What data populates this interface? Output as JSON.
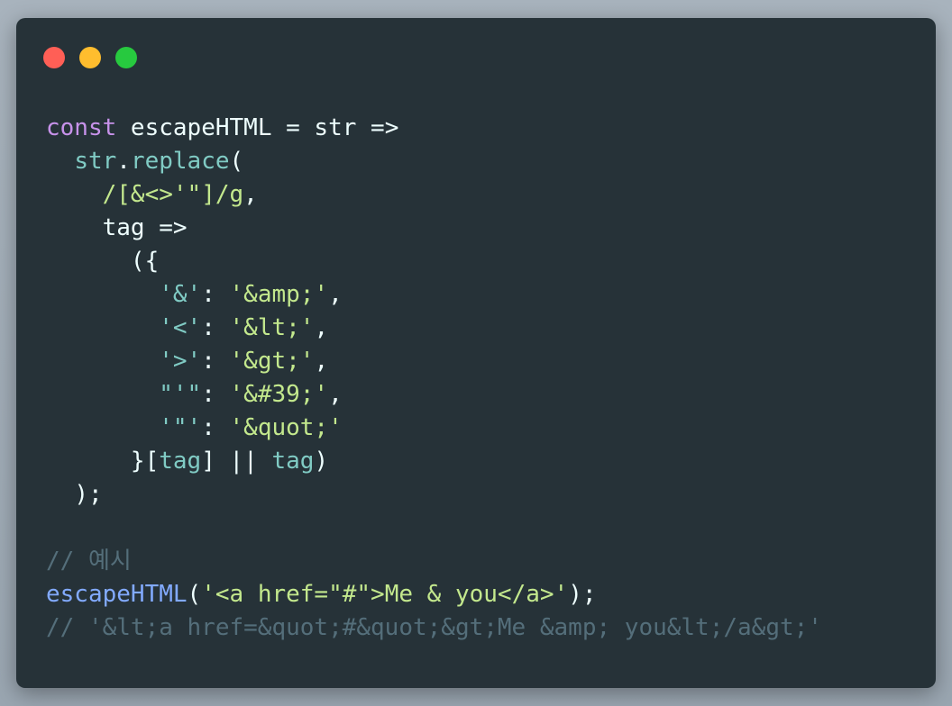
{
  "window": {
    "buttons": {
      "close": "close",
      "minimize": "minimize",
      "maximize": "maximize"
    }
  },
  "code": {
    "l1": {
      "kw": "const",
      "rest": " escapeHTML = str =>"
    },
    "l2": {
      "indent": "  ",
      "obj": "str",
      "dot": ".",
      "method": "replace",
      "paren": "("
    },
    "l3": {
      "indent": "    ",
      "regex": "/[&<>'\"]/g",
      "comma": ","
    },
    "l4": {
      "indent": "    ",
      "text": "tag =>"
    },
    "l5": {
      "indent": "      ",
      "text": "({"
    },
    "l6": {
      "indent": "        ",
      "key": "'&'",
      "colon": ": ",
      "val": "'&amp;'",
      "comma": ","
    },
    "l7": {
      "indent": "        ",
      "key": "'<'",
      "colon": ": ",
      "val": "'&lt;'",
      "comma": ","
    },
    "l8": {
      "indent": "        ",
      "key": "'>'",
      "colon": ": ",
      "val": "'&gt;'",
      "comma": ","
    },
    "l9": {
      "indent": "        ",
      "key": "\"'\"",
      "colon": ": ",
      "val": "'&#39;'",
      "comma": ","
    },
    "l10": {
      "indent": "        ",
      "key": "'\"'",
      "colon": ": ",
      "val": "'&quot;'"
    },
    "l11": {
      "indent": "      ",
      "open": "}[",
      "tag1": "tag",
      "mid": "] || ",
      "tag2": "tag",
      "close": ")"
    },
    "l12": {
      "indent": "  ",
      "text": ");"
    },
    "l13": {
      "text": ""
    },
    "l14": {
      "comment": "// 예시"
    },
    "l15": {
      "fn": "escapeHTML",
      "open": "(",
      "arg": "'<a href=\"#\">Me & you</a>'",
      "close": ");"
    },
    "l16": {
      "comment": "// '&lt;a href=&quot;#&quot;&gt;Me &amp; you&lt;/a&gt;'"
    }
  },
  "colors": {
    "background": "#263238",
    "keyword": "#c792ea",
    "function": "#82aaff",
    "property": "#80cbc4",
    "string": "#c3e88d",
    "comment": "#546e7a",
    "text": "#eeffff"
  }
}
